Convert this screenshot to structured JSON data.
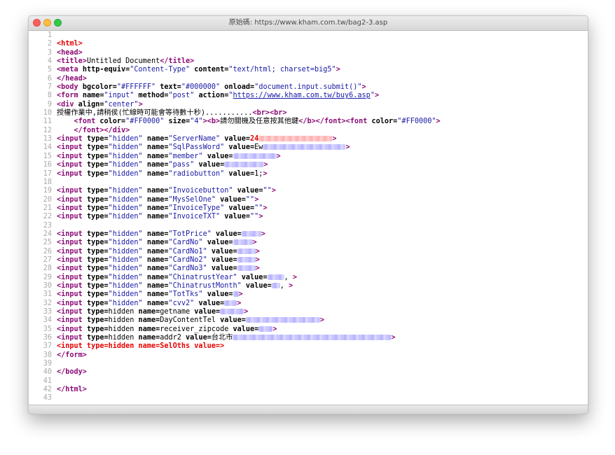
{
  "window": {
    "title": "原始碼: https://www.kham.com.tw/bag2-3.asp"
  },
  "lines": [
    {
      "n": "1",
      "parts": []
    },
    {
      "n": "2",
      "parts": [
        [
          "red",
          "<html>"
        ]
      ]
    },
    {
      "n": "3",
      "parts": [
        [
          "tag",
          "<head>"
        ]
      ]
    },
    {
      "n": "4",
      "parts": [
        [
          "tag",
          "<title>"
        ],
        [
          "txt",
          "Untitled Document"
        ],
        [
          "tag",
          "</title>"
        ]
      ]
    },
    {
      "n": "5",
      "parts": [
        [
          "tag",
          "<meta "
        ],
        [
          "b",
          "http-equiv="
        ],
        [
          "val",
          "\"Content-Type\""
        ],
        [
          "b",
          " content="
        ],
        [
          "val",
          "\"text/html; charset=big5\""
        ],
        [
          "tag",
          ">"
        ]
      ]
    },
    {
      "n": "6",
      "parts": [
        [
          "tag",
          "</head>"
        ]
      ]
    },
    {
      "n": "7",
      "parts": [
        [
          "tag",
          "<body "
        ],
        [
          "b",
          "bgcolor="
        ],
        [
          "val",
          "\"#FFFFFF\""
        ],
        [
          "b",
          " text="
        ],
        [
          "val",
          "\"#000000\""
        ],
        [
          "b",
          " onload="
        ],
        [
          "val",
          "\"document.input.submit()\""
        ],
        [
          "tag",
          ">"
        ]
      ]
    },
    {
      "n": "8",
      "parts": [
        [
          "tag",
          "<form "
        ],
        [
          "b",
          "name="
        ],
        [
          "val",
          "\"input\""
        ],
        [
          "b",
          " method="
        ],
        [
          "val",
          "\"post\""
        ],
        [
          "b",
          " action="
        ],
        [
          "val",
          "\""
        ],
        [
          "link",
          "https://www.kham.com.tw/buy6.asp"
        ],
        [
          "val",
          "\""
        ],
        [
          "tag",
          ">"
        ]
      ]
    },
    {
      "n": "9",
      "parts": [
        [
          "tag",
          "<div "
        ],
        [
          "b",
          "align="
        ],
        [
          "val",
          "\"center\""
        ],
        [
          "tag",
          ">"
        ]
      ]
    },
    {
      "n": "10",
      "parts": [
        [
          "txt",
          "授權作業中,請稍侯(忙線時可能會等待數十秒)..........."
        ],
        [
          "tag",
          "<br><br>"
        ]
      ]
    },
    {
      "n": "11",
      "parts": [
        [
          "txt",
          "    "
        ],
        [
          "tag",
          "<font "
        ],
        [
          "b",
          "color="
        ],
        [
          "val",
          "\"#FF0000\""
        ],
        [
          "b",
          " size="
        ],
        [
          "val",
          "\"4\""
        ],
        [
          "tag",
          "><b>"
        ],
        [
          "txt",
          "請勿關機及任意按其他鍵"
        ],
        [
          "tag",
          "</b></font><font "
        ],
        [
          "b",
          "color="
        ],
        [
          "val",
          "\"#FF0000\""
        ],
        [
          "tag",
          ">"
        ]
      ]
    },
    {
      "n": "12",
      "parts": [
        [
          "txt",
          "    "
        ],
        [
          "tag",
          "</font></div>"
        ]
      ]
    },
    {
      "n": "13",
      "parts": [
        [
          "tag",
          "<input "
        ],
        [
          "b",
          "type="
        ],
        [
          "val",
          "\"hidden\""
        ],
        [
          "b",
          " name="
        ],
        [
          "val",
          "\"ServerName\""
        ],
        [
          "b",
          " value="
        ],
        [
          "red",
          "24"
        ],
        [
          "blurpink",
          "105"
        ],
        [
          "tag",
          ">"
        ]
      ]
    },
    {
      "n": "14",
      "parts": [
        [
          "tag",
          "<input "
        ],
        [
          "b",
          "type="
        ],
        [
          "val",
          "\"hidden\""
        ],
        [
          "b",
          " name="
        ],
        [
          "val",
          "\"SqlPassWord\""
        ],
        [
          "b",
          " value="
        ],
        [
          "txt",
          "Ew"
        ],
        [
          "blur",
          "118"
        ],
        [
          "tag",
          ">"
        ]
      ]
    },
    {
      "n": "15",
      "parts": [
        [
          "tag",
          "<input "
        ],
        [
          "b",
          "type="
        ],
        [
          "val",
          "\"hidden\""
        ],
        [
          "b",
          " name="
        ],
        [
          "val",
          "\"member\""
        ],
        [
          "b",
          " value="
        ],
        [
          "blur",
          "62"
        ],
        [
          "tag",
          ">"
        ]
      ]
    },
    {
      "n": "16",
      "parts": [
        [
          "tag",
          "<input "
        ],
        [
          "b",
          "type="
        ],
        [
          "val",
          "\"hidden\""
        ],
        [
          "b",
          " name="
        ],
        [
          "val",
          "\"pass\""
        ],
        [
          "b",
          " value="
        ],
        [
          "blur",
          "56"
        ],
        [
          "tag",
          ">"
        ]
      ]
    },
    {
      "n": "17",
      "parts": [
        [
          "tag",
          "<input "
        ],
        [
          "b",
          "type="
        ],
        [
          "val",
          "\"hidden\""
        ],
        [
          "b",
          " name="
        ],
        [
          "val",
          "\"radiobutton\""
        ],
        [
          "b",
          " value="
        ],
        [
          "txt",
          "1;"
        ],
        [
          "tag",
          ">"
        ]
      ]
    },
    {
      "n": "18",
      "parts": []
    },
    {
      "n": "19",
      "parts": [
        [
          "tag",
          "<input "
        ],
        [
          "b",
          "type="
        ],
        [
          "val",
          "\"hidden\""
        ],
        [
          "b",
          " name="
        ],
        [
          "val",
          "\"Invoicebutton\""
        ],
        [
          "b",
          " value="
        ],
        [
          "val",
          "\"\""
        ],
        [
          "tag",
          ">"
        ]
      ]
    },
    {
      "n": "20",
      "parts": [
        [
          "tag",
          "<input "
        ],
        [
          "b",
          "type="
        ],
        [
          "val",
          "\"hidden\""
        ],
        [
          "b",
          " name="
        ],
        [
          "val",
          "\"MysSelOne\""
        ],
        [
          "b",
          " value="
        ],
        [
          "val",
          "\"\""
        ],
        [
          "tag",
          ">"
        ]
      ]
    },
    {
      "n": "21",
      "parts": [
        [
          "tag",
          "<input "
        ],
        [
          "b",
          "type="
        ],
        [
          "val",
          "\"hidden\""
        ],
        [
          "b",
          " name="
        ],
        [
          "val",
          "\"InvoiceType\""
        ],
        [
          "b",
          " value="
        ],
        [
          "val",
          "\"\""
        ],
        [
          "tag",
          ">"
        ]
      ]
    },
    {
      "n": "22",
      "parts": [
        [
          "tag",
          "<input "
        ],
        [
          "b",
          "type="
        ],
        [
          "val",
          "\"hidden\""
        ],
        [
          "b",
          " name="
        ],
        [
          "val",
          "\"InvoiceTXT\""
        ],
        [
          "b",
          " value="
        ],
        [
          "val",
          "\"\""
        ],
        [
          "tag",
          ">"
        ]
      ]
    },
    {
      "n": "23",
      "parts": []
    },
    {
      "n": "24",
      "parts": [
        [
          "tag",
          "<input "
        ],
        [
          "b",
          "type="
        ],
        [
          "val",
          "\"hidden\""
        ],
        [
          "b",
          " name="
        ],
        [
          "val",
          "\"TotPrice\""
        ],
        [
          "b",
          " value="
        ],
        [
          "blur",
          "28"
        ],
        [
          "tag",
          ">"
        ]
      ]
    },
    {
      "n": "25",
      "parts": [
        [
          "tag",
          "<input "
        ],
        [
          "b",
          "type="
        ],
        [
          "val",
          "\"hidden\""
        ],
        [
          "b",
          " name="
        ],
        [
          "val",
          "\"CardNo\""
        ],
        [
          "b",
          " value="
        ],
        [
          "blur",
          "28"
        ],
        [
          "tag",
          ">"
        ]
      ]
    },
    {
      "n": "26",
      "parts": [
        [
          "tag",
          "<input "
        ],
        [
          "b",
          "type="
        ],
        [
          "val",
          "\"hidden\""
        ],
        [
          "b",
          " name="
        ],
        [
          "val",
          "\"CardNo1\""
        ],
        [
          "b",
          " value="
        ],
        [
          "blur",
          "26"
        ],
        [
          "tag",
          ">"
        ]
      ]
    },
    {
      "n": "27",
      "parts": [
        [
          "tag",
          "<input "
        ],
        [
          "b",
          "type="
        ],
        [
          "val",
          "\"hidden\""
        ],
        [
          "b",
          " name="
        ],
        [
          "val",
          "\"CardNo2\""
        ],
        [
          "b",
          " value="
        ],
        [
          "blur",
          "26"
        ],
        [
          "tag",
          ">"
        ]
      ]
    },
    {
      "n": "28",
      "parts": [
        [
          "tag",
          "<input "
        ],
        [
          "b",
          "type="
        ],
        [
          "val",
          "\"hidden\""
        ],
        [
          "b",
          " name="
        ],
        [
          "val",
          "\"CardNo3\""
        ],
        [
          "b",
          " value="
        ],
        [
          "blur",
          "26"
        ],
        [
          "tag",
          ">"
        ]
      ]
    },
    {
      "n": "29",
      "parts": [
        [
          "tag",
          "<input "
        ],
        [
          "b",
          "type="
        ],
        [
          "val",
          "\"hidden\""
        ],
        [
          "b",
          " name="
        ],
        [
          "val",
          "\"ChinatrustYear\""
        ],
        [
          "b",
          " value="
        ],
        [
          "blur",
          "24"
        ],
        [
          "txt",
          ", "
        ],
        [
          "tag",
          ">"
        ]
      ]
    },
    {
      "n": "30",
      "parts": [
        [
          "tag",
          "<input "
        ],
        [
          "b",
          "type="
        ],
        [
          "val",
          "\"hidden\""
        ],
        [
          "b",
          " name="
        ],
        [
          "val",
          "\"ChinatrustMonth\""
        ],
        [
          "b",
          " value="
        ],
        [
          "blur",
          "12"
        ],
        [
          "txt",
          ", "
        ],
        [
          "tag",
          ">"
        ]
      ]
    },
    {
      "n": "31",
      "parts": [
        [
          "tag",
          "<input "
        ],
        [
          "b",
          "type="
        ],
        [
          "val",
          "\"hidden\""
        ],
        [
          "b",
          " name="
        ],
        [
          "val",
          "\"TotTks\""
        ],
        [
          "b",
          " value="
        ],
        [
          "blur",
          "8"
        ],
        [
          "tag",
          ">"
        ]
      ]
    },
    {
      "n": "32",
      "parts": [
        [
          "tag",
          "<input "
        ],
        [
          "b",
          "type="
        ],
        [
          "val",
          "\"hidden\""
        ],
        [
          "b",
          " name="
        ],
        [
          "val",
          "\"cvv2\""
        ],
        [
          "b",
          " value="
        ],
        [
          "blur",
          "18"
        ],
        [
          "tag",
          ">"
        ]
      ]
    },
    {
      "n": "33",
      "parts": [
        [
          "tag",
          "<input "
        ],
        [
          "b",
          "type="
        ],
        [
          "txt",
          "hidden"
        ],
        [
          "b",
          " name="
        ],
        [
          "txt",
          "getname"
        ],
        [
          "b",
          " value="
        ],
        [
          "blur",
          "34"
        ],
        [
          "tag",
          ">"
        ]
      ]
    },
    {
      "n": "34",
      "parts": [
        [
          "tag",
          "<input "
        ],
        [
          "b",
          "type="
        ],
        [
          "txt",
          "hidden"
        ],
        [
          "b",
          " name="
        ],
        [
          "txt",
          "DayContentTel"
        ],
        [
          "b",
          " value="
        ],
        [
          "blur",
          "106"
        ],
        [
          "tag",
          ">"
        ]
      ]
    },
    {
      "n": "35",
      "parts": [
        [
          "tag",
          "<input "
        ],
        [
          "b",
          "type="
        ],
        [
          "txt",
          "hidden"
        ],
        [
          "b",
          " name="
        ],
        [
          "txt",
          "receiver_zipcode"
        ],
        [
          "b",
          " value="
        ],
        [
          "blur",
          "20"
        ],
        [
          "tag",
          ">"
        ]
      ]
    },
    {
      "n": "36",
      "parts": [
        [
          "tag",
          "<input "
        ],
        [
          "b",
          "type="
        ],
        [
          "txt",
          "hidden"
        ],
        [
          "b",
          " name="
        ],
        [
          "txt",
          "addr2"
        ],
        [
          "b",
          " value="
        ],
        [
          "txt",
          "台北市"
        ],
        [
          "blur",
          "226"
        ],
        [
          "tag",
          ">"
        ]
      ]
    },
    {
      "n": "37",
      "parts": [
        [
          "red",
          "<input type=hidden name=SelOths value=>"
        ]
      ]
    },
    {
      "n": "38",
      "parts": [
        [
          "tag",
          "</form>"
        ]
      ]
    },
    {
      "n": "39",
      "parts": []
    },
    {
      "n": "40",
      "parts": [
        [
          "tag",
          "</body>"
        ]
      ]
    },
    {
      "n": "41",
      "parts": []
    },
    {
      "n": "42",
      "parts": [
        [
          "tag",
          "</html>"
        ]
      ]
    },
    {
      "n": "43",
      "parts": []
    }
  ]
}
